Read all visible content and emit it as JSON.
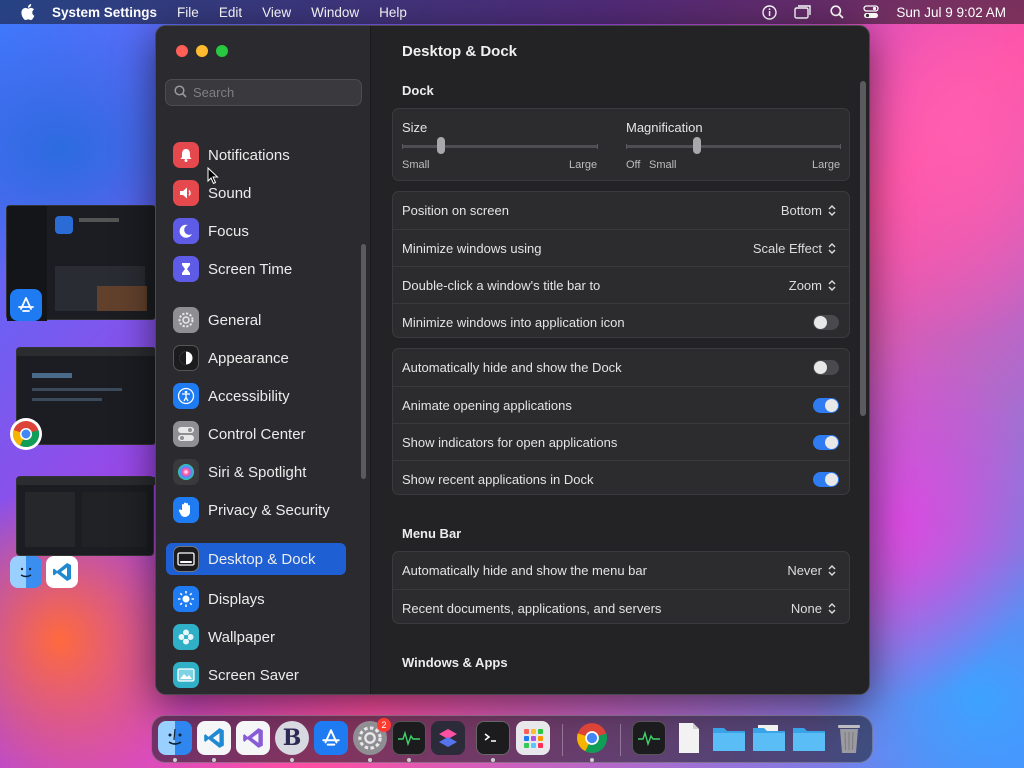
{
  "menubar": {
    "app_name": "System Settings",
    "menus": [
      "File",
      "Edit",
      "View",
      "Window",
      "Help"
    ],
    "clock": "Sun Jul 9  9:02 AM"
  },
  "sidebar": {
    "search_placeholder": "Search",
    "items": [
      {
        "label": "Notifications",
        "icon": "bell-icon",
        "color": "#e5484d"
      },
      {
        "label": "Sound",
        "icon": "speaker-icon",
        "color": "#e5484d"
      },
      {
        "label": "Focus",
        "icon": "moon-icon",
        "color": "#5e5ce6"
      },
      {
        "label": "Screen Time",
        "icon": "hourglass-icon",
        "color": "#5e5ce6"
      },
      {
        "label": "General",
        "icon": "gear-icon",
        "color": "#8e8e93"
      },
      {
        "label": "Appearance",
        "icon": "appearance-icon",
        "color": "#1c1c1e"
      },
      {
        "label": "Accessibility",
        "icon": "accessibility-icon",
        "color": "#1e7bf2"
      },
      {
        "label": "Control Center",
        "icon": "switches-icon",
        "color": "#8e8e93"
      },
      {
        "label": "Siri & Spotlight",
        "icon": "siri-icon",
        "color": "#3a3a3c"
      },
      {
        "label": "Privacy & Security",
        "icon": "hand-icon",
        "color": "#1e7bf2"
      },
      {
        "label": "Desktop & Dock",
        "icon": "dock-icon",
        "color": "#1c1c1e"
      },
      {
        "label": "Displays",
        "icon": "sun-icon",
        "color": "#1e7bf2"
      },
      {
        "label": "Wallpaper",
        "icon": "flower-icon",
        "color": "#30b0c7"
      },
      {
        "label": "Screen Saver",
        "icon": "screensaver-icon",
        "color": "#30b0c7"
      }
    ],
    "selected": "Desktop & Dock"
  },
  "content": {
    "title": "Desktop & Dock",
    "dock_section": "Dock",
    "size": {
      "label": "Size",
      "min_label": "Small",
      "max_label": "Large",
      "value": 0.2
    },
    "magnification": {
      "label": "Magnification",
      "off_label": "Off",
      "min_label": "Small",
      "max_label": "Large",
      "value": 0.33
    },
    "popups": [
      {
        "label": "Position on screen",
        "value": "Bottom"
      },
      {
        "label": "Minimize windows using",
        "value": "Scale Effect"
      },
      {
        "label": "Double-click a window's title bar to",
        "value": "Zoom"
      }
    ],
    "minimize_into_icon": {
      "label": "Minimize windows into application icon",
      "on": false
    },
    "dock_toggles": [
      {
        "label": "Automatically hide and show the Dock",
        "on": false
      },
      {
        "label": "Animate opening applications",
        "on": true
      },
      {
        "label": "Show indicators for open applications",
        "on": true
      },
      {
        "label": "Show recent applications in Dock",
        "on": true
      }
    ],
    "menubar_section": "Menu Bar",
    "menubar_rows": [
      {
        "label": "Automatically hide and show the menu bar",
        "value": "Never"
      },
      {
        "label": "Recent documents, applications, and servers",
        "value": "None"
      }
    ],
    "windows_section": "Windows & Apps"
  },
  "dock": {
    "apps": [
      "Finder",
      "Visual Studio Code",
      "Visual Studio",
      "BBEdit",
      "App Store",
      "System Settings",
      "Activity Monitor",
      "Shortcuts",
      "Terminal",
      "Launchpad",
      "Google Chrome",
      "Activity Monitor",
      "Document",
      "Folder",
      "Folder",
      "Folder",
      "Trash"
    ],
    "settings_badge": "2"
  },
  "colors": {
    "accent": "#1f5fd4",
    "toggle_on": "#2f7bf2"
  }
}
